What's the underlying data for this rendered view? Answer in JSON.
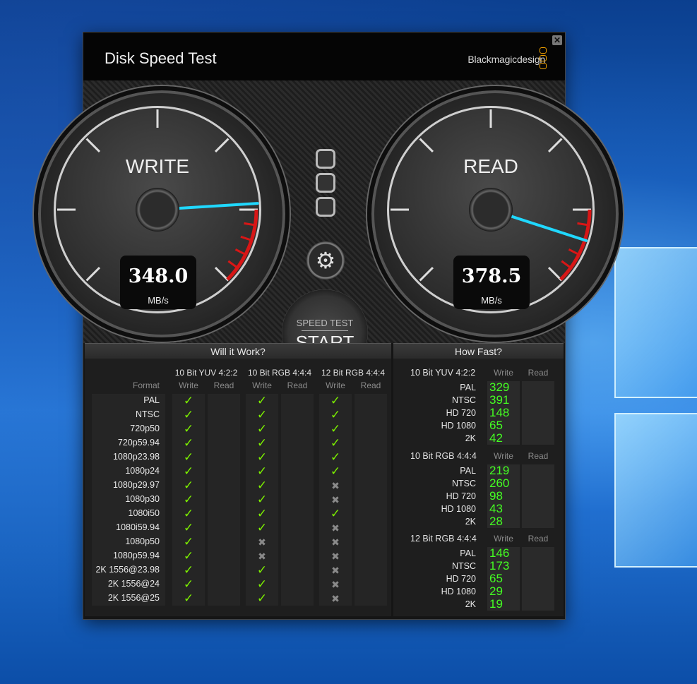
{
  "app": {
    "title": "Disk Speed Test",
    "brand": "Blackmagicdesign",
    "close_label": "✕"
  },
  "gauges": {
    "write": {
      "label": "WRITE",
      "value": "348.0",
      "unit": "MB/s",
      "needle_fraction": 0.82
    },
    "read": {
      "label": "READ",
      "value": "378.5",
      "unit": "MB/s",
      "needle_fraction": 0.9
    }
  },
  "controls": {
    "start_top": "SPEED TEST",
    "start_bottom": "START",
    "gear_icon": "gear-icon"
  },
  "will_it_work": {
    "heading": "Will it Work?",
    "format_label": "Format",
    "groups": [
      {
        "title": "10 Bit YUV 4:2:2",
        "write": "Write",
        "read": "Read"
      },
      {
        "title": "10 Bit RGB 4:4:4",
        "write": "Write",
        "read": "Read"
      },
      {
        "title": "12 Bit RGB 4:4:4",
        "write": "Write",
        "read": "Read"
      }
    ],
    "rows": [
      {
        "format": "PAL",
        "w": [
          "ok",
          "ok",
          "ok"
        ]
      },
      {
        "format": "NTSC",
        "w": [
          "ok",
          "ok",
          "ok"
        ]
      },
      {
        "format": "720p50",
        "w": [
          "ok",
          "ok",
          "ok"
        ]
      },
      {
        "format": "720p59.94",
        "w": [
          "ok",
          "ok",
          "ok"
        ]
      },
      {
        "format": "1080p23.98",
        "w": [
          "ok",
          "ok",
          "ok"
        ]
      },
      {
        "format": "1080p24",
        "w": [
          "ok",
          "ok",
          "ok"
        ]
      },
      {
        "format": "1080p29.97",
        "w": [
          "ok",
          "ok",
          "no"
        ]
      },
      {
        "format": "1080p30",
        "w": [
          "ok",
          "ok",
          "no"
        ]
      },
      {
        "format": "1080i50",
        "w": [
          "ok",
          "ok",
          "ok"
        ]
      },
      {
        "format": "1080i59.94",
        "w": [
          "ok",
          "ok",
          "no"
        ]
      },
      {
        "format": "1080p50",
        "w": [
          "ok",
          "no",
          "no"
        ]
      },
      {
        "format": "1080p59.94",
        "w": [
          "ok",
          "no",
          "no"
        ]
      },
      {
        "format": "2K 1556@23.98",
        "w": [
          "ok",
          "ok",
          "no"
        ]
      },
      {
        "format": "2K 1556@24",
        "w": [
          "ok",
          "ok",
          "no"
        ]
      },
      {
        "format": "2K 1556@25",
        "w": [
          "ok",
          "ok",
          "no"
        ]
      }
    ]
  },
  "how_fast": {
    "heading": "How Fast?",
    "groups": [
      {
        "title": "10 Bit YUV 4:2:2",
        "write": "Write",
        "read": "Read",
        "rows": [
          {
            "label": "PAL",
            "value": "329"
          },
          {
            "label": "NTSC",
            "value": "391"
          },
          {
            "label": "HD 720",
            "value": "148"
          },
          {
            "label": "HD 1080",
            "value": "65"
          },
          {
            "label": "2K",
            "value": "42"
          }
        ]
      },
      {
        "title": "10 Bit RGB 4:4:4",
        "write": "Write",
        "read": "Read",
        "rows": [
          {
            "label": "PAL",
            "value": "219"
          },
          {
            "label": "NTSC",
            "value": "260"
          },
          {
            "label": "HD 720",
            "value": "98"
          },
          {
            "label": "HD 1080",
            "value": "43"
          },
          {
            "label": "2K",
            "value": "28"
          }
        ]
      },
      {
        "title": "12 Bit RGB 4:4:4",
        "write": "Write",
        "read": "Read",
        "rows": [
          {
            "label": "PAL",
            "value": "146"
          },
          {
            "label": "NTSC",
            "value": "173"
          },
          {
            "label": "HD 720",
            "value": "65"
          },
          {
            "label": "HD 1080",
            "value": "29"
          },
          {
            "label": "2K",
            "value": "19"
          }
        ]
      }
    ]
  }
}
